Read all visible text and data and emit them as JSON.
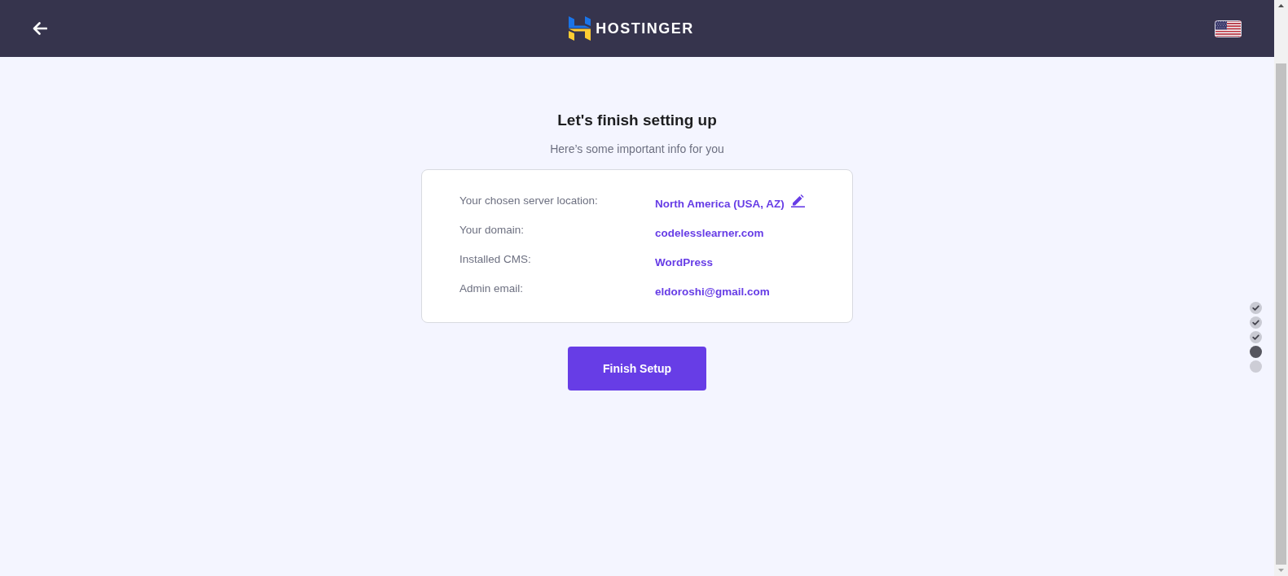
{
  "header": {
    "logo_text": "HOSTINGER"
  },
  "setup": {
    "title": "Let's finish setting up",
    "subtitle": "Here’s some important info for you",
    "details": [
      {
        "label": "Your chosen server location:",
        "value": "North America (USA, AZ)",
        "editable": true
      },
      {
        "label": "Your domain:",
        "value": "codelesslearner.com",
        "editable": false
      },
      {
        "label": "Installed CMS:",
        "value": "WordPress",
        "editable": false
      },
      {
        "label": "Admin email:",
        "value": "eldoroshi@gmail.com",
        "editable": false
      }
    ],
    "button": "Finish Setup"
  },
  "steps": [
    {
      "completed": true,
      "selected": false
    },
    {
      "completed": true,
      "selected": false
    },
    {
      "completed": true,
      "selected": false
    },
    {
      "completed": false,
      "selected": true
    },
    {
      "completed": false,
      "selected": false
    }
  ]
}
